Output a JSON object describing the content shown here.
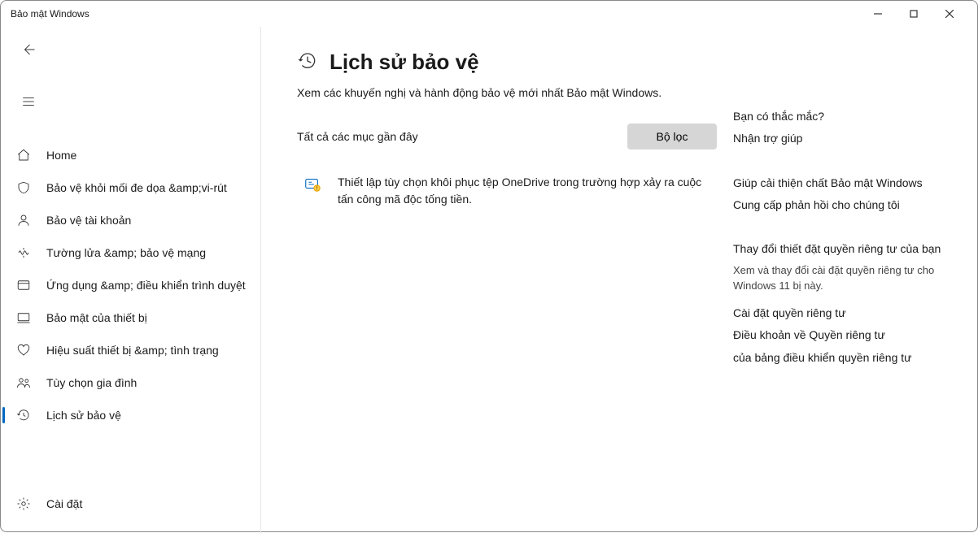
{
  "window": {
    "title": "Bảo mật Windows"
  },
  "nav": {
    "items": [
      {
        "label": "Home"
      },
      {
        "label": "Bảo vệ khỏi mối đe dọa &amp;vi-rút"
      },
      {
        "label": "Bảo vệ tài khoản"
      },
      {
        "label": "Tường lửa &amp; bảo vệ mạng"
      },
      {
        "label": "Ứng dụng &amp; điều khiển trình duyệt"
      },
      {
        "label": "Bảo mật của thiết bị"
      },
      {
        "label": "Hiệu suất thiết bị &amp; tình trạng"
      },
      {
        "label": "Tùy chọn gia đình"
      },
      {
        "label": "Lịch sử bảo vệ"
      }
    ],
    "settings": "Cài đặt"
  },
  "page": {
    "title": "Lịch sử bảo vệ",
    "subtitle": "Xem các khuyến nghị và hành động bảo vệ mới nhất Bảo mật Windows.",
    "recent_label": "Tất cả các mục gần đây",
    "filter_label": "Bộ lọc",
    "recommendation": "Thiết lập tùy chọn khôi phục tệp OneDrive trong trường hợp xảy ra cuộc tấn công mã độc tống tiền."
  },
  "aside": {
    "q_head": "Bạn có thắc mắc?",
    "q_link": "Nhận trợ giúp",
    "improve_head": "Giúp cải thiện chất Bảo mật Windows",
    "improve_link": "Cung cấp phản hồi cho chúng tôi",
    "privacy_head": "Thay đổi thiết đặt quyền riêng tư của bạn",
    "privacy_text": "Xem và thay đổi cài đặt quyền riêng tư cho Windows 11 bị này.",
    "privacy_link1": "Cài đặt quyền riêng tư",
    "privacy_link2": "Điều khoản về Quyền riêng tư",
    "privacy_link3": "của bảng điều khiển quyền riêng tư"
  }
}
